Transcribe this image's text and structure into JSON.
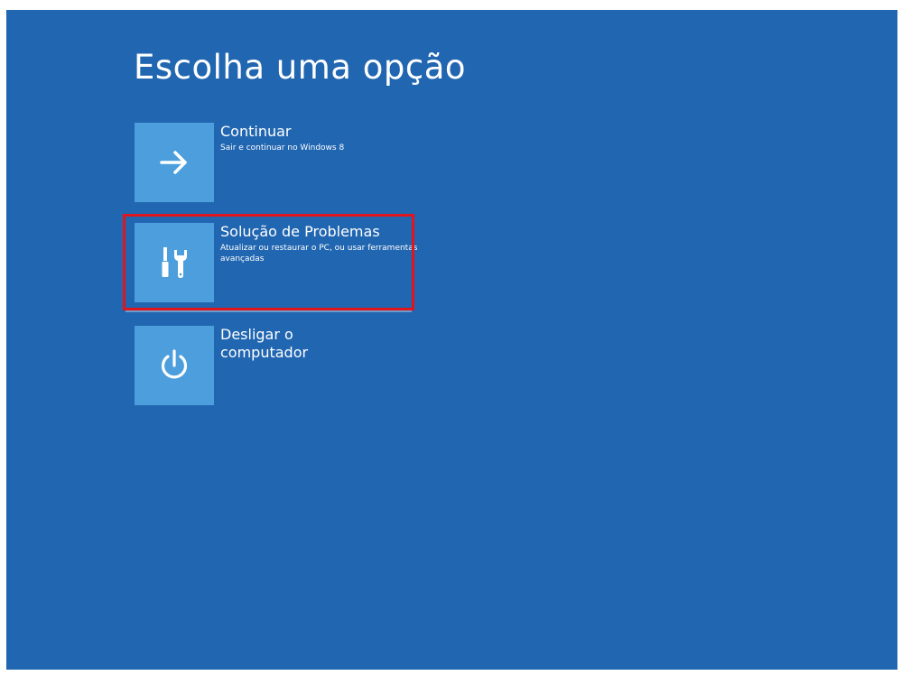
{
  "screen": {
    "title": "Escolha uma opção"
  },
  "options": [
    {
      "title": "Continuar",
      "description": "Sair e continuar no Windows 8",
      "icon": "arrow-right-icon"
    },
    {
      "title": "Solução de Problemas",
      "description": "Atualizar ou restaurar o PC, ou usar ferramentas avançadas",
      "icon": "tools-icon",
      "highlighted": true
    },
    {
      "title": "Desligar o computador",
      "description": "",
      "icon": "power-icon"
    }
  ],
  "colors": {
    "background": "#2166b1",
    "tile": "#4c9fdc",
    "text": "#ffffff",
    "highlight": "#e0161c"
  }
}
